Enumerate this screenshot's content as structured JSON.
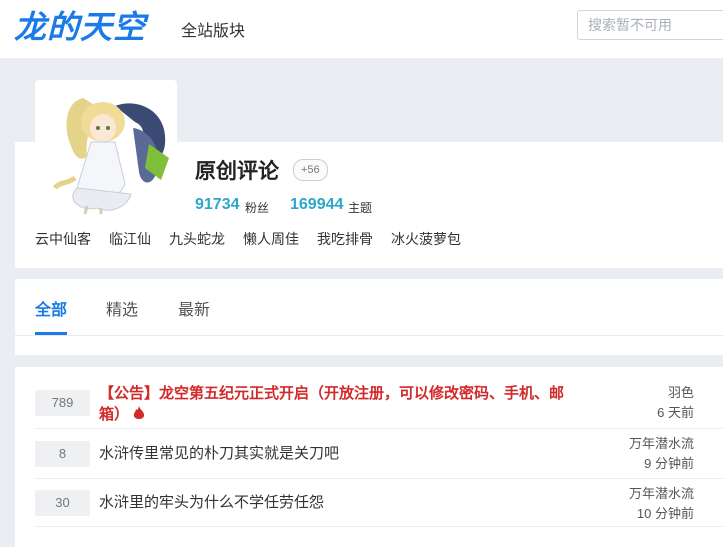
{
  "header": {
    "logo_text": "龙的天空",
    "nav_label": "全站版块",
    "search_placeholder": "搜索暂不可用"
  },
  "forum": {
    "title": "原创评论",
    "badge": "+56",
    "fans_count": "91734",
    "fans_label": "粉丝",
    "topics_count": "169944",
    "topics_label": "主题",
    "moderators": [
      "云中仙客",
      "临江仙",
      "九头蛇龙",
      "懒人周佳",
      "我吃排骨",
      "冰火菠萝包"
    ]
  },
  "tabs": [
    {
      "label": "全部",
      "active": true
    },
    {
      "label": "精选",
      "active": false
    },
    {
      "label": "最新",
      "active": false
    }
  ],
  "posts": [
    {
      "count": "789",
      "title": "【公告】龙空第五纪元正式开启（开放注册，可以修改密码、手机、邮箱）",
      "author": "羽色",
      "time": "6 天前",
      "announcement": true
    },
    {
      "count": "8",
      "title": "水浒传里常见的朴刀其实就是关刀吧",
      "author": "万年潜水流",
      "time": "9 分钟前",
      "announcement": false
    },
    {
      "count": "30",
      "title": "水浒里的牢头为什么不学任劳任怨",
      "author": "万年潜水流",
      "time": "10 分钟前",
      "announcement": false
    }
  ],
  "colors": {
    "brand": "#1a7be8",
    "stat": "#2aa7c9",
    "announcement": "#d22a2a",
    "page_bg": "#eaeef3"
  }
}
